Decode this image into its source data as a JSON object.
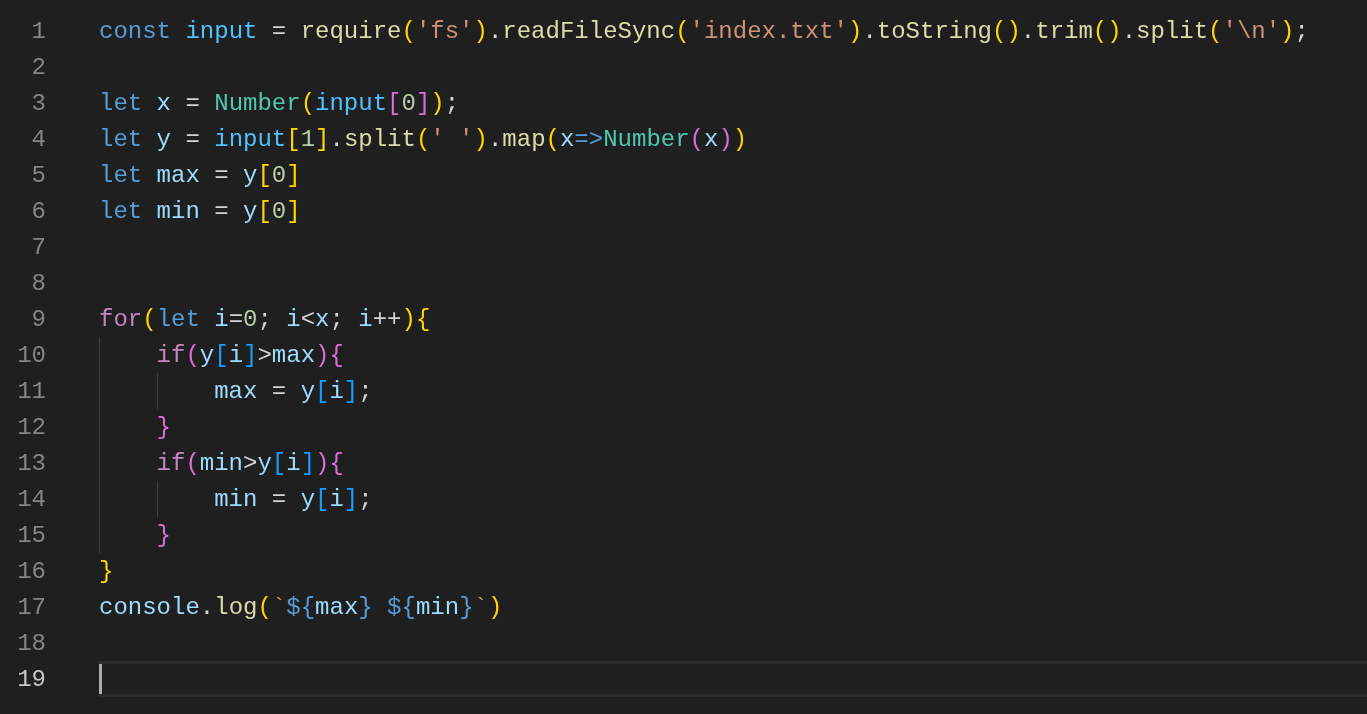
{
  "editor": {
    "lines": [
      {
        "number": "1",
        "current": false,
        "tokens": [
          {
            "text": "const ",
            "kind": "kw"
          },
          {
            "text": "input",
            "kind": "const"
          },
          {
            "text": " = ",
            "kind": "p"
          },
          {
            "text": "require",
            "kind": "fn"
          },
          {
            "text": "(",
            "kind": "b1"
          },
          {
            "text": "'fs'",
            "kind": "str"
          },
          {
            "text": ")",
            "kind": "b1"
          },
          {
            "text": ".",
            "kind": "p"
          },
          {
            "text": "readFileSync",
            "kind": "fn"
          },
          {
            "text": "(",
            "kind": "b1"
          },
          {
            "text": "'index.txt'",
            "kind": "str"
          },
          {
            "text": ")",
            "kind": "b1"
          },
          {
            "text": ".",
            "kind": "p"
          },
          {
            "text": "toString",
            "kind": "fn"
          },
          {
            "text": "()",
            "kind": "b1"
          },
          {
            "text": ".",
            "kind": "p"
          },
          {
            "text": "trim",
            "kind": "fn"
          },
          {
            "text": "()",
            "kind": "b1"
          },
          {
            "text": ".",
            "kind": "p"
          },
          {
            "text": "split",
            "kind": "fn"
          },
          {
            "text": "(",
            "kind": "b1"
          },
          {
            "text": "'\\n'",
            "kind": "str"
          },
          {
            "text": ")",
            "kind": "b1"
          },
          {
            "text": ";",
            "kind": "p"
          }
        ]
      },
      {
        "number": "2",
        "current": false
      },
      {
        "number": "3",
        "current": false,
        "tokens": [
          {
            "text": "let ",
            "kind": "kw"
          },
          {
            "text": "x",
            "kind": "var"
          },
          {
            "text": " = ",
            "kind": "p"
          },
          {
            "text": "Number",
            "kind": "cls"
          },
          {
            "text": "(",
            "kind": "b1"
          },
          {
            "text": "input",
            "kind": "const"
          },
          {
            "text": "[",
            "kind": "b2"
          },
          {
            "text": "0",
            "kind": "num"
          },
          {
            "text": "]",
            "kind": "b2"
          },
          {
            "text": ")",
            "kind": "b1"
          },
          {
            "text": ";",
            "kind": "p"
          }
        ]
      },
      {
        "number": "4",
        "current": false,
        "tokens": [
          {
            "text": "let ",
            "kind": "kw"
          },
          {
            "text": "y",
            "kind": "var"
          },
          {
            "text": " = ",
            "kind": "p"
          },
          {
            "text": "input",
            "kind": "const"
          },
          {
            "text": "[",
            "kind": "b1"
          },
          {
            "text": "1",
            "kind": "num"
          },
          {
            "text": "]",
            "kind": "b1"
          },
          {
            "text": ".",
            "kind": "p"
          },
          {
            "text": "split",
            "kind": "fn"
          },
          {
            "text": "(",
            "kind": "b1"
          },
          {
            "text": "' '",
            "kind": "str"
          },
          {
            "text": ")",
            "kind": "b1"
          },
          {
            "text": ".",
            "kind": "p"
          },
          {
            "text": "map",
            "kind": "fn"
          },
          {
            "text": "(",
            "kind": "b1"
          },
          {
            "text": "x",
            "kind": "var"
          },
          {
            "text": "=>",
            "kind": "kw"
          },
          {
            "text": "Number",
            "kind": "cls"
          },
          {
            "text": "(",
            "kind": "b2"
          },
          {
            "text": "x",
            "kind": "var"
          },
          {
            "text": ")",
            "kind": "b2"
          },
          {
            "text": ")",
            "kind": "b1"
          }
        ]
      },
      {
        "number": "5",
        "current": false,
        "tokens": [
          {
            "text": "let ",
            "kind": "kw"
          },
          {
            "text": "max",
            "kind": "var"
          },
          {
            "text": " = ",
            "kind": "p"
          },
          {
            "text": "y",
            "kind": "var"
          },
          {
            "text": "[",
            "kind": "b1"
          },
          {
            "text": "0",
            "kind": "num"
          },
          {
            "text": "]",
            "kind": "b1"
          }
        ]
      },
      {
        "number": "6",
        "current": false,
        "tokens": [
          {
            "text": "let ",
            "kind": "kw"
          },
          {
            "text": "min",
            "kind": "var"
          },
          {
            "text": " = ",
            "kind": "p"
          },
          {
            "text": "y",
            "kind": "var"
          },
          {
            "text": "[",
            "kind": "b1"
          },
          {
            "text": "0",
            "kind": "num"
          },
          {
            "text": "]",
            "kind": "b1"
          }
        ]
      },
      {
        "number": "7",
        "current": false
      },
      {
        "number": "8",
        "current": false
      },
      {
        "number": "9",
        "current": false,
        "tokens": [
          {
            "text": "for",
            "kind": "ctl"
          },
          {
            "text": "(",
            "kind": "b1"
          },
          {
            "text": "let ",
            "kind": "kw"
          },
          {
            "text": "i",
            "kind": "var"
          },
          {
            "text": "=",
            "kind": "p"
          },
          {
            "text": "0",
            "kind": "num"
          },
          {
            "text": "; ",
            "kind": "p"
          },
          {
            "text": "i",
            "kind": "var"
          },
          {
            "text": "<",
            "kind": "p"
          },
          {
            "text": "x",
            "kind": "var"
          },
          {
            "text": "; ",
            "kind": "p"
          },
          {
            "text": "i",
            "kind": "var"
          },
          {
            "text": "++",
            "kind": "p"
          },
          {
            "text": ")",
            "kind": "b1"
          },
          {
            "text": "{",
            "kind": "b1"
          }
        ],
        "children": [
          {
            "number": "10",
            "current": false,
            "tokens": [
              {
                "text": "if",
                "kind": "ctl"
              },
              {
                "text": "(",
                "kind": "b2"
              },
              {
                "text": "y",
                "kind": "var"
              },
              {
                "text": "[",
                "kind": "b3"
              },
              {
                "text": "i",
                "kind": "var"
              },
              {
                "text": "]",
                "kind": "b3"
              },
              {
                "text": ">",
                "kind": "p"
              },
              {
                "text": "max",
                "kind": "var"
              },
              {
                "text": ")",
                "kind": "b2"
              },
              {
                "text": "{",
                "kind": "b2"
              }
            ],
            "children": [
              {
                "number": "11",
                "current": false,
                "tokens": [
                  {
                    "text": "max",
                    "kind": "var"
                  },
                  {
                    "text": " = ",
                    "kind": "p"
                  },
                  {
                    "text": "y",
                    "kind": "var"
                  },
                  {
                    "text": "[",
                    "kind": "b3"
                  },
                  {
                    "text": "i",
                    "kind": "var"
                  },
                  {
                    "text": "]",
                    "kind": "b3"
                  },
                  {
                    "text": ";",
                    "kind": "p"
                  }
                ]
              }
            ]
          },
          {
            "number": "12",
            "current": false,
            "tokens": [
              {
                "text": "}",
                "kind": "b2"
              }
            ]
          },
          {
            "number": "13",
            "current": false,
            "tokens": [
              {
                "text": "if",
                "kind": "ctl"
              },
              {
                "text": "(",
                "kind": "b2"
              },
              {
                "text": "min",
                "kind": "var"
              },
              {
                "text": ">",
                "kind": "p"
              },
              {
                "text": "y",
                "kind": "var"
              },
              {
                "text": "[",
                "kind": "b3"
              },
              {
                "text": "i",
                "kind": "var"
              },
              {
                "text": "]",
                "kind": "b3"
              },
              {
                "text": ")",
                "kind": "b2"
              },
              {
                "text": "{",
                "kind": "b2"
              }
            ],
            "children": [
              {
                "number": "14",
                "current": false,
                "tokens": [
                  {
                    "text": "min",
                    "kind": "var"
                  },
                  {
                    "text": " = ",
                    "kind": "p"
                  },
                  {
                    "text": "y",
                    "kind": "var"
                  },
                  {
                    "text": "[",
                    "kind": "b3"
                  },
                  {
                    "text": "i",
                    "kind": "var"
                  },
                  {
                    "text": "]",
                    "kind": "b3"
                  },
                  {
                    "text": ";",
                    "kind": "p"
                  }
                ]
              }
            ]
          },
          {
            "number": "15",
            "current": false,
            "tokens": [
              {
                "text": "}",
                "kind": "b2"
              }
            ]
          }
        ]
      },
      {
        "number": "16",
        "current": false,
        "tokens": [
          {
            "text": "}",
            "kind": "b1"
          }
        ]
      },
      {
        "number": "17",
        "current": false,
        "tokens": [
          {
            "text": "console",
            "kind": "var"
          },
          {
            "text": ".",
            "kind": "p"
          },
          {
            "text": "log",
            "kind": "fn"
          },
          {
            "text": "(",
            "kind": "b1"
          },
          {
            "text": "`",
            "kind": "str"
          },
          {
            "text": "${",
            "kind": "kw"
          },
          {
            "text": "max",
            "kind": "var"
          },
          {
            "text": "} ",
            "kind": "kw"
          },
          {
            "text": "${",
            "kind": "kw"
          },
          {
            "text": "min",
            "kind": "var"
          },
          {
            "text": "}",
            "kind": "kw"
          },
          {
            "text": "`",
            "kind": "str"
          },
          {
            "text": ")",
            "kind": "b1"
          }
        ]
      },
      {
        "number": "18",
        "current": false
      },
      {
        "number": "19",
        "current": true
      }
    ]
  }
}
